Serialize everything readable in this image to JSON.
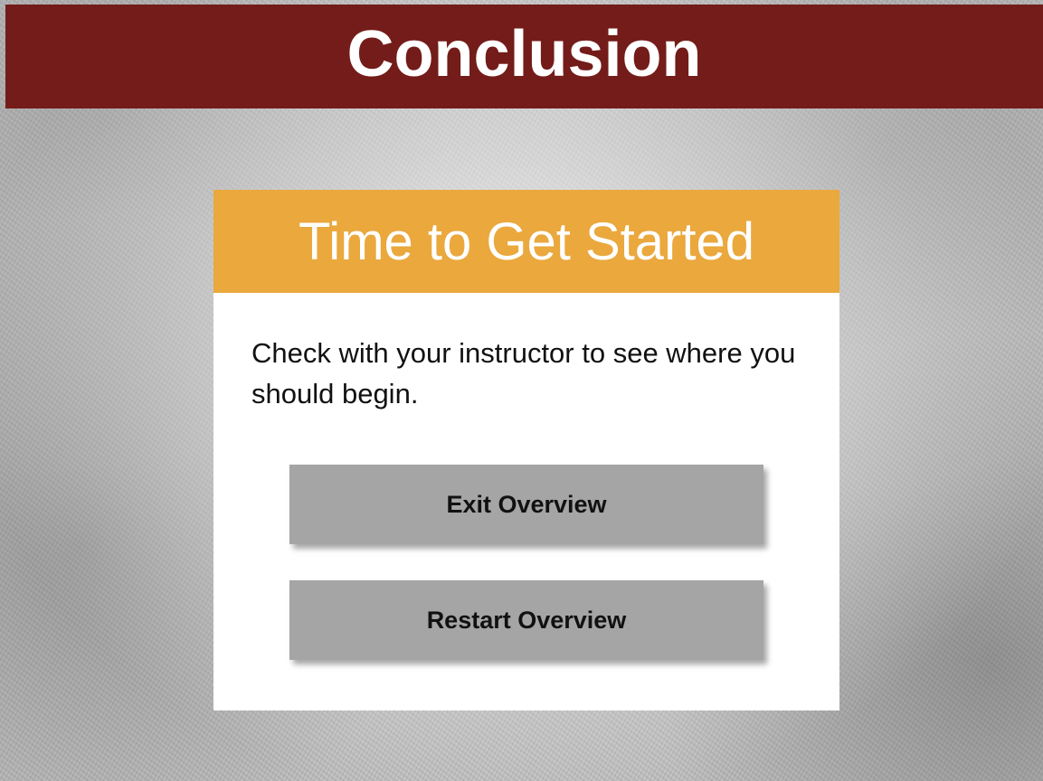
{
  "header": {
    "title": "Conclusion"
  },
  "panel": {
    "title": "Time to Get Started",
    "body": "Check with your instructor to see where you should begin."
  },
  "buttons": {
    "exit_label": "Exit Overview",
    "restart_label": "Restart Overview"
  },
  "colors": {
    "header_background": "#731c19",
    "panel_header_background": "#eaa83d",
    "button_background": "#a5a5a5",
    "panel_background": "#ffffff"
  }
}
